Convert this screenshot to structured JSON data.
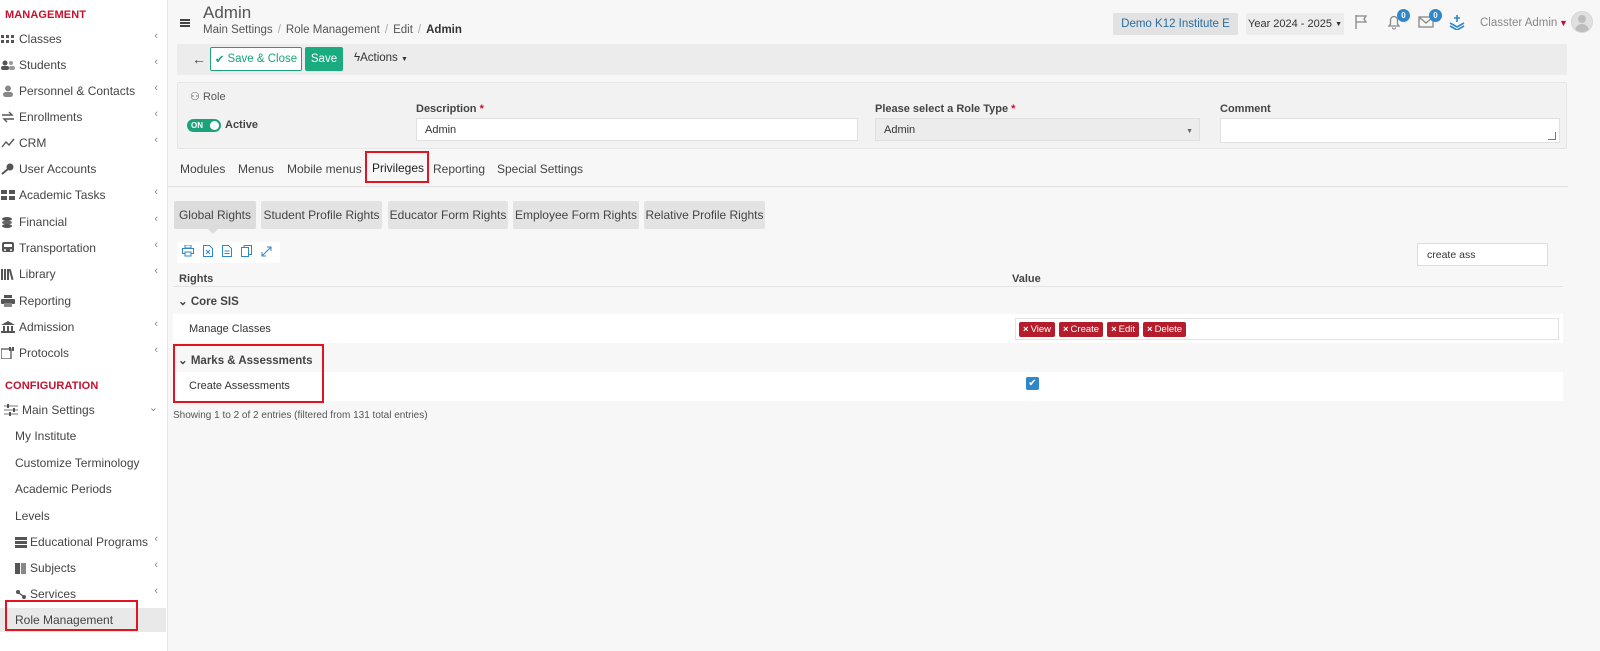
{
  "sidebar": {
    "sections": [
      "MANAGEMENT",
      "CONFIGURATION"
    ],
    "management_items": [
      {
        "label": "Classes",
        "icon": "classes-icon",
        "chev": "‹"
      },
      {
        "label": "Students",
        "icon": "students-icon",
        "chev": "‹"
      },
      {
        "label": "Personnel & Contacts",
        "icon": "personnel-icon",
        "chev": "‹"
      },
      {
        "label": "Enrollments",
        "icon": "enrollments-icon",
        "chev": "‹"
      },
      {
        "label": "CRM",
        "icon": "crm-icon",
        "chev": "‹"
      },
      {
        "label": "User Accounts",
        "icon": "key-icon",
        "chev": ""
      },
      {
        "label": "Academic Tasks",
        "icon": "tasks-icon",
        "chev": "‹"
      },
      {
        "label": "Financial",
        "icon": "coins-icon",
        "chev": "‹"
      },
      {
        "label": "Transportation",
        "icon": "bus-icon",
        "chev": "‹"
      },
      {
        "label": "Library",
        "icon": "library-icon",
        "chev": "‹"
      },
      {
        "label": "Reporting",
        "icon": "printer-icon",
        "chev": ""
      },
      {
        "label": "Admission",
        "icon": "institution-icon",
        "chev": "‹"
      },
      {
        "label": "Protocols",
        "icon": "protocols-icon",
        "chev": "‹"
      }
    ],
    "main_settings": {
      "label": "Main Settings",
      "chev": "⌄"
    },
    "config_items": [
      {
        "label": "My Institute",
        "chev": ""
      },
      {
        "label": "Customize Terminology",
        "chev": ""
      },
      {
        "label": "Academic Periods",
        "chev": ""
      },
      {
        "label": "Levels",
        "chev": ""
      },
      {
        "label": "Educational Programs",
        "chev": "‹"
      },
      {
        "label": "Subjects",
        "chev": "‹"
      },
      {
        "label": "Services",
        "chev": "‹"
      },
      {
        "label": "Role Management",
        "chev": ""
      }
    ]
  },
  "header": {
    "title": "Admin",
    "breadcrumb": [
      "Main Settings",
      "Role Management",
      "Edit",
      "Admin"
    ],
    "institute": "Demo K12 Institute E",
    "year": "Year 2024 - 2025",
    "notif_count": "0",
    "mail_count": "0",
    "user": "Classter Admin"
  },
  "toolbar": {
    "save_close": "Save & Close",
    "save": "Save",
    "actions": "Actions"
  },
  "form": {
    "role_label": "Role",
    "toggle_text": "ON",
    "active_label": "Active",
    "description_label": "Description",
    "description_value": "Admin",
    "role_type_label": "Please select a Role Type",
    "role_type_value": "Admin",
    "comment_label": "Comment",
    "comment_value": "",
    "required_mark": "*"
  },
  "tabs": [
    "Modules",
    "Menus",
    "Mobile menus",
    "Privileges",
    "Reporting",
    "Special Settings"
  ],
  "subtabs": [
    "Global Rights",
    "Student Profile Rights",
    "Educator Form Rights",
    "Employee Form Rights",
    "Relative Profile Rights"
  ],
  "search": {
    "value": "create ass"
  },
  "table": {
    "headers": [
      "Rights",
      "Value"
    ],
    "groups": [
      {
        "name": "Core SIS",
        "rows": [
          {
            "right": "Manage Classes",
            "chips": [
              "View",
              "Create",
              "Edit",
              "Delete"
            ]
          }
        ]
      },
      {
        "name": "Marks & Assessments",
        "rows": [
          {
            "right": "Create Assessments",
            "checked": true
          }
        ]
      }
    ],
    "info": "Showing 1 to 2 of 2 entries (filtered from 131 total entries)"
  },
  "colors": {
    "accent": "#1aa37a",
    "brand_red": "#c8102e",
    "chip": "#b51d2c",
    "highlight": "#e0151f"
  }
}
